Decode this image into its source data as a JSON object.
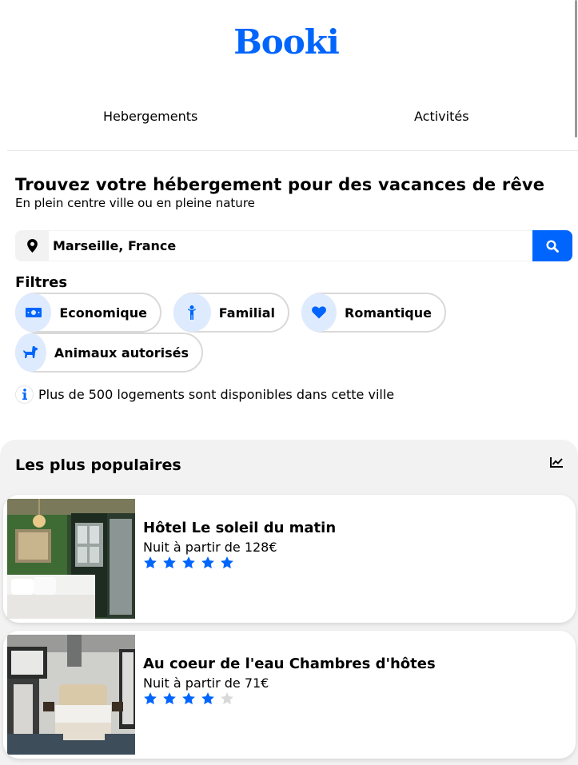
{
  "brand": {
    "logo": "Booki",
    "color": "#0065FC"
  },
  "nav": {
    "items": [
      "Hebergements",
      "Activités"
    ]
  },
  "hero": {
    "title": "Trouvez votre hébergement pour des vacances de rêve",
    "subtitle": "En plein centre ville ou en pleine nature"
  },
  "search": {
    "value": "Marseille, France",
    "pin_icon": "map-pin-icon",
    "button_icon": "search-icon"
  },
  "filters": {
    "title": "Filtres",
    "items": [
      {
        "label": "Economique",
        "icon": "money-icon"
      },
      {
        "label": "Familial",
        "icon": "child-icon"
      },
      {
        "label": "Romantique",
        "icon": "heart-icon"
      },
      {
        "label": "Animaux autorisés",
        "icon": "dog-icon"
      }
    ]
  },
  "info": {
    "text": "Plus de 500 logements sont disponibles dans cette ville",
    "icon": "info-icon"
  },
  "popular": {
    "title": "Les plus populaires",
    "icon": "trend-chart-icon",
    "items": [
      {
        "name": "Hôtel Le soleil du matin",
        "price": "Nuit à partir de 128€",
        "rating": 5
      },
      {
        "name": "Au coeur de l'eau Chambres d'hôtes",
        "price": "Nuit à partir de 71€",
        "rating": 4
      }
    ]
  },
  "colors": {
    "primary": "#0065FC",
    "secondary": "#DEEBFF",
    "background": "#F2F2F2",
    "star_off": "#D9D9D9"
  }
}
